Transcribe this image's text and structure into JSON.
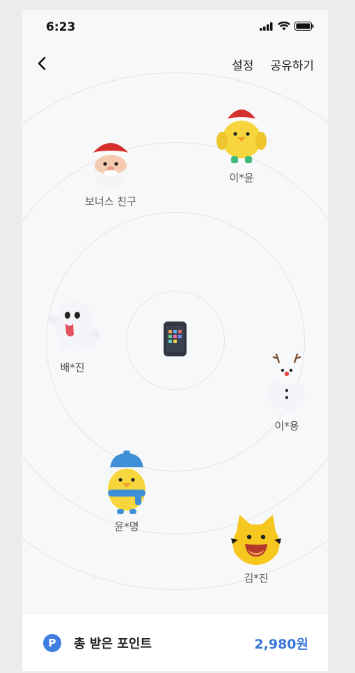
{
  "status": {
    "time": "6:23"
  },
  "nav": {
    "settings": "설정",
    "share": "공유하기"
  },
  "friends": [
    {
      "name": "보너스 친구",
      "character": "santa-character-icon"
    },
    {
      "name": "이*윤",
      "character": "chick-santa-hat-character-icon"
    },
    {
      "name": "배*진",
      "character": "ghost-character-icon"
    },
    {
      "name": "이*용",
      "character": "snowman-character-icon"
    },
    {
      "name": "윤*명",
      "character": "chick-beanie-character-icon"
    },
    {
      "name": "김*진",
      "character": "yellow-cat-character-icon"
    }
  ],
  "bottom": {
    "label": "총 받은 포인트",
    "value": "2,980원",
    "badge": "P"
  },
  "colors": {
    "accent": "#3a78d8",
    "background": "#f7f8fa"
  }
}
